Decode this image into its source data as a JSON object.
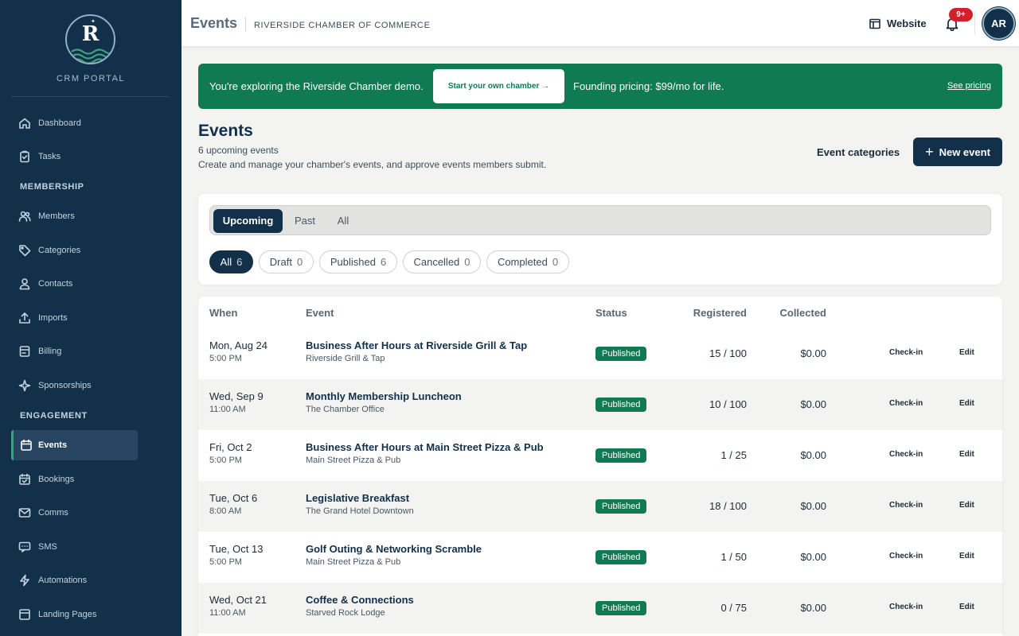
{
  "colors": {
    "sidebar_bg": "#12304a",
    "accent_green": "#0f7a54",
    "primary_navy": "#12304a",
    "badge_red": "#d21f2c"
  },
  "sidebar": {
    "logo_letter": "R",
    "logo_caption": "CRM PORTAL",
    "items": [
      {
        "label": "Dashboard",
        "icon": "home-icon"
      },
      {
        "label": "Tasks",
        "icon": "clipboard-check-icon"
      },
      {
        "label": "Members",
        "icon": "users-icon"
      },
      {
        "label": "Categories",
        "icon": "tag-icon"
      },
      {
        "label": "Contacts",
        "icon": "user-icon"
      },
      {
        "label": "Imports",
        "icon": "upload-icon"
      },
      {
        "label": "Billing",
        "icon": "credit-card-icon"
      },
      {
        "label": "Sponsorships",
        "icon": "sparkle-icon"
      },
      {
        "label": "Events",
        "icon": "calendar-icon",
        "active": true
      },
      {
        "label": "Bookings",
        "icon": "calendar-check-icon"
      },
      {
        "label": "Comms",
        "icon": "mail-icon"
      },
      {
        "label": "SMS",
        "icon": "message-icon"
      },
      {
        "label": "Automations",
        "icon": "lightning-icon"
      },
      {
        "label": "Landing Pages",
        "icon": "layout-icon"
      }
    ],
    "sections": {
      "membership": "MEMBERSHIP",
      "engagement": "ENGAGEMENT"
    }
  },
  "topbar": {
    "title": "Events",
    "org_name": "RIVERSIDE CHAMBER OF COMMERCE",
    "website_label": "Website",
    "notification_count": "9+",
    "avatar_initials": "AR"
  },
  "banner": {
    "text": "You're exploring the Riverside Chamber demo.",
    "cta_label": "Start your own chamber →",
    "pricing_text": "Founding pricing: $99/mo for life.",
    "link_label": "See pricing"
  },
  "page": {
    "title": "Events",
    "subtitle_count": "6 upcoming events",
    "subtitle_desc": "Create and manage your chamber's events, and approve events members submit.",
    "categories_label": "Event categories",
    "new_event_label": "New event"
  },
  "tabs": [
    {
      "label": "Upcoming",
      "active": true
    },
    {
      "label": "Past"
    },
    {
      "label": "All"
    }
  ],
  "chips": [
    {
      "label": "All",
      "count": "6",
      "active": true
    },
    {
      "label": "Draft",
      "count": "0"
    },
    {
      "label": "Published",
      "count": "6"
    },
    {
      "label": "Cancelled",
      "count": "0"
    },
    {
      "label": "Completed",
      "count": "0"
    }
  ],
  "table": {
    "headers": {
      "when": "When",
      "event": "Event",
      "status": "Status",
      "registered": "Registered",
      "collected": "Collected"
    },
    "rows": [
      {
        "date": "Mon, Aug 24",
        "time": "5:00 PM",
        "name": "Business After Hours at Riverside Grill & Tap",
        "venue": "Riverside Grill & Tap",
        "status": "Published",
        "registered": "15 / 100",
        "collected": "$0.00",
        "checkin": "Check-in",
        "edit": "Edit"
      },
      {
        "date": "Wed, Sep 9",
        "time": "11:00 AM",
        "name": "Monthly Membership Luncheon",
        "venue": "The Chamber Office",
        "status": "Published",
        "registered": "10 / 100",
        "collected": "$0.00",
        "checkin": "Check-in",
        "edit": "Edit"
      },
      {
        "date": "Fri, Oct 2",
        "time": "5:00 PM",
        "name": "Business After Hours at Main Street Pizza & Pub",
        "venue": "Main Street Pizza & Pub",
        "status": "Published",
        "registered": "1 / 25",
        "collected": "$0.00",
        "checkin": "Check-in",
        "edit": "Edit"
      },
      {
        "date": "Tue, Oct 6",
        "time": "8:00 AM",
        "name": "Legislative Breakfast",
        "venue": "The Grand Hotel Downtown",
        "status": "Published",
        "registered": "18 / 100",
        "collected": "$0.00",
        "checkin": "Check-in",
        "edit": "Edit"
      },
      {
        "date": "Tue, Oct 13",
        "time": "5:00 PM",
        "name": "Golf Outing & Networking Scramble",
        "venue": "Main Street Pizza & Pub",
        "status": "Published",
        "registered": "1 / 50",
        "collected": "$0.00",
        "checkin": "Check-in",
        "edit": "Edit"
      },
      {
        "date": "Wed, Oct 21",
        "time": "11:00 AM",
        "name": "Coffee & Connections",
        "venue": "Starved Rock Lodge",
        "status": "Published",
        "registered": "0 / 75",
        "collected": "$0.00",
        "checkin": "Check-in",
        "edit": "Edit"
      }
    ]
  }
}
